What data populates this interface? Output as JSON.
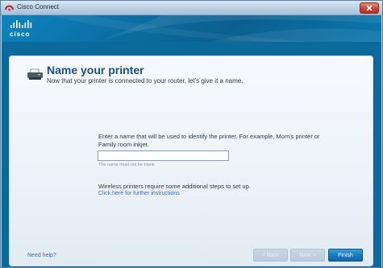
{
  "window": {
    "title": "Cisco Connect"
  },
  "header": {
    "logo_text": "cisco"
  },
  "page": {
    "title": "Name your printer",
    "subtitle": "Now that your printer is connected to your router, let's give it a name."
  },
  "form": {
    "instruction": "Enter a name that will be used to identify the printer. For example, Mom's printer or Family room inkjet.",
    "printer_name_value": "",
    "hint": "The name must not be blank"
  },
  "wireless": {
    "note": "Wireless printers require some additional steps to set up.",
    "link": "Click here for further instructions"
  },
  "footer": {
    "help_link": "Need help?",
    "back_label": "< Back",
    "next_label": "Next >",
    "finish_label": "Finish"
  },
  "colors": {
    "brand_blue": "#0b6a9e",
    "title_blue": "#1b4f8a",
    "link_blue": "#2e6fc0",
    "finish_button": "#1479be",
    "close_button": "#c9412b"
  },
  "icons": {
    "app": "cisco-app-icon",
    "close": "close-icon",
    "printer": "printer-icon"
  }
}
